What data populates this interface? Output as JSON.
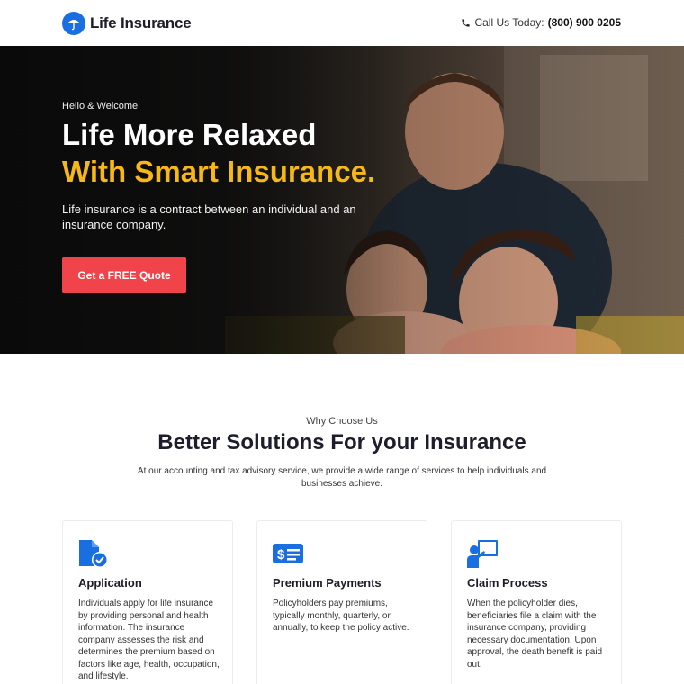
{
  "header": {
    "brand": "Life Insurance",
    "call_label": "Call Us Today:",
    "phone": "(800) 900 0205"
  },
  "hero": {
    "greeting": "Hello & Welcome",
    "headline_line1": "Life More Relaxed",
    "headline_line2": "With Smart Insurance.",
    "description": "Life insurance is a contract between an individual and an insurance company.",
    "cta_label": "Get a FREE Quote"
  },
  "section": {
    "eyebrow": "Why Choose Us",
    "title": "Better Solutions For your Insurance",
    "description": "At our accounting and tax advisory service, we provide a wide range of services to help individuals and businesses achieve."
  },
  "cards": [
    {
      "icon": "document-check-icon",
      "title": "Application",
      "body": "Individuals apply for life insurance by providing personal and health information. The insurance company assesses the risk and determines the premium based on factors like age, health, occupation, and lifestyle."
    },
    {
      "icon": "dollar-card-icon",
      "title": "Premium Payments",
      "body": "Policyholders pay premiums, typically monthly, quarterly, or annually, to keep the policy active."
    },
    {
      "icon": "presenter-board-icon",
      "title": "Claim Process",
      "body": "When the policyholder dies, beneficiaries file a claim with the insurance company, providing necessary documentation. Upon approval, the death benefit is paid out."
    }
  ],
  "colors": {
    "brand_blue": "#1a6fe0",
    "accent_yellow": "#f7b817",
    "cta_red": "#f0444a"
  }
}
